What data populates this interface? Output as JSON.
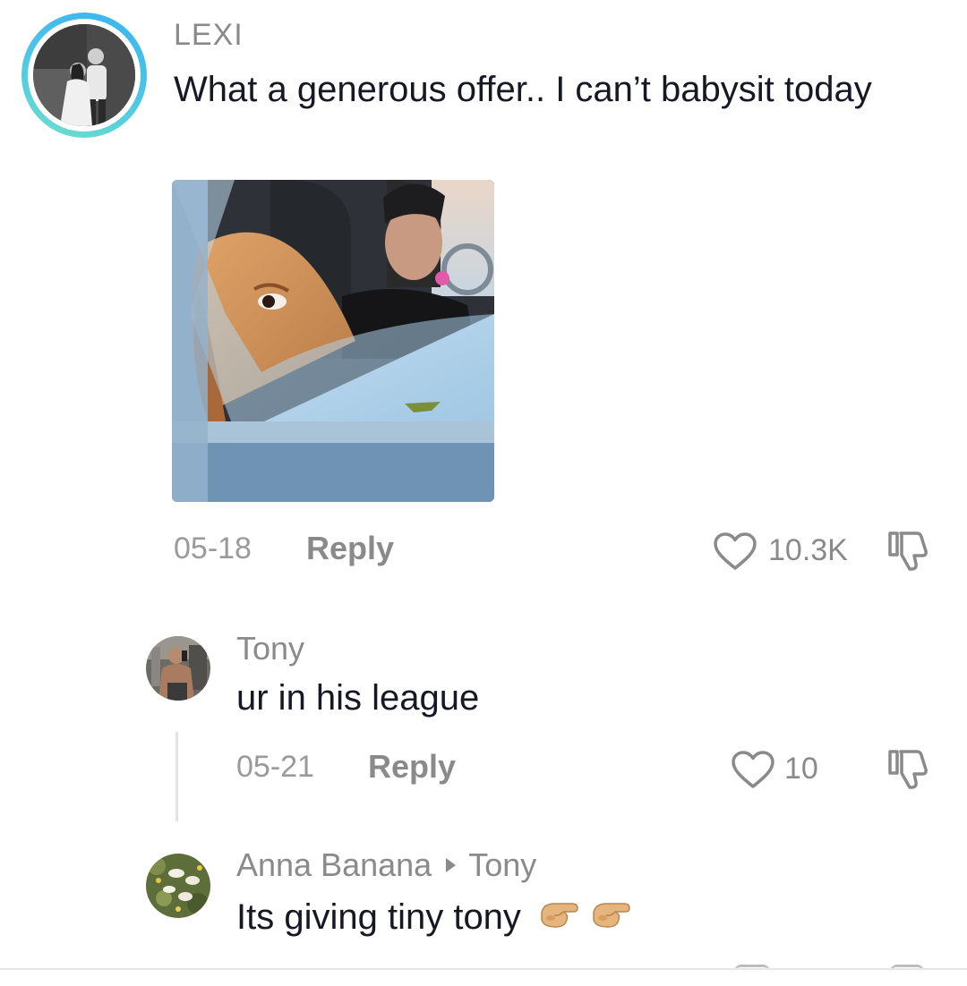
{
  "comment": {
    "username": "LEXI",
    "text": "What a generous offer.. I can’t babysit today",
    "date": "05-18",
    "reply_label": "Reply",
    "likes": "10.3K"
  },
  "replies": [
    {
      "username": "Tony",
      "text": "ur in his league",
      "date": "05-21",
      "reply_label": "Reply",
      "likes": "10"
    },
    {
      "username": "Anna Banana",
      "reply_to": "Tony",
      "text": "Its giving tiny tony",
      "emoji": [
        "pinching-hand",
        "pinching-hand"
      ]
    }
  ],
  "colors": {
    "text_primary": "#161823",
    "text_secondary": "#8a8a8a",
    "avatar_ring": "#4fc8e6"
  }
}
